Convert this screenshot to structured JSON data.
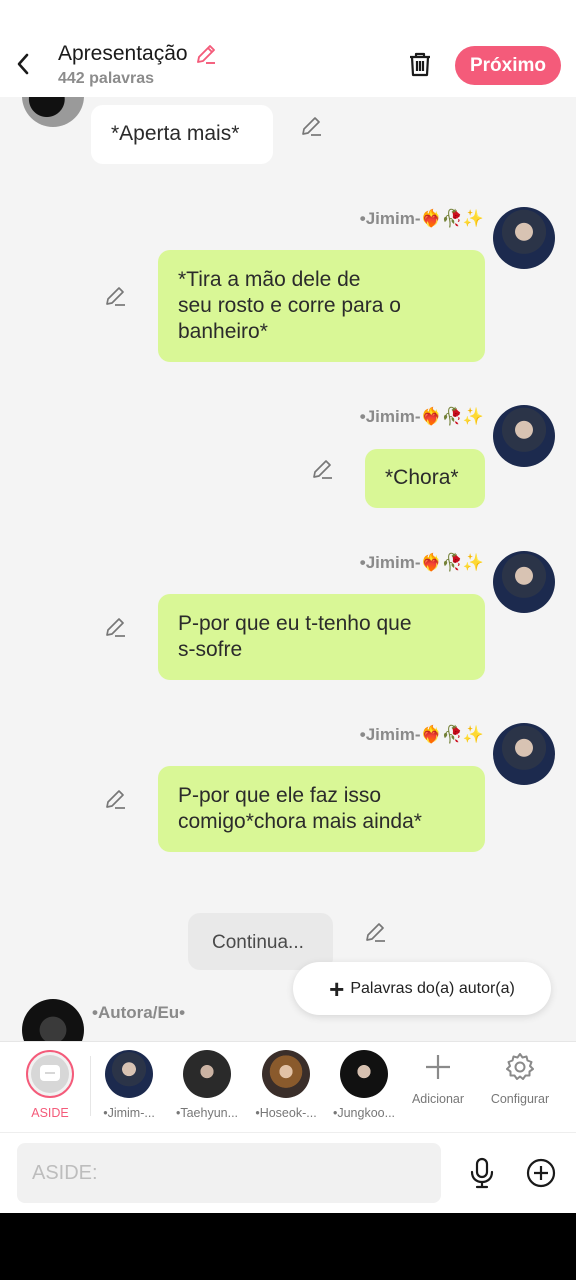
{
  "header": {
    "title": "Apresentação",
    "word_count": "442 palavras",
    "next_label": "Próximo"
  },
  "messages": [
    {
      "author": "",
      "text": "*Aperta mais*",
      "side": "left"
    },
    {
      "author": "•Jimim-❤️‍🔥🥀✨",
      "text": "*Tira a mão dele de\nseu rosto e corre para o\nbanheiro*",
      "side": "right"
    },
    {
      "author": "•Jimim-❤️‍🔥🥀✨",
      "text": "*Chora*",
      "side": "right"
    },
    {
      "author": "•Jimim-❤️‍🔥🥀✨",
      "text": "P-por que eu t-tenho que\ns-sofre",
      "side": "right"
    },
    {
      "author": "•Jimim-❤️‍🔥🥀✨",
      "text": "P-por que ele faz isso\ncomigo*chora mais ainda*",
      "side": "right"
    },
    {
      "author": "",
      "text": "Continua...",
      "side": "aside"
    },
    {
      "author": "•Autora/Eu•",
      "text": "",
      "side": "left"
    }
  ],
  "float_button": {
    "label": "Palavras do(a) autor(a)"
  },
  "characters": [
    {
      "label": "ASIDE"
    },
    {
      "label": "•Jimim-..."
    },
    {
      "label": "•Taehyun..."
    },
    {
      "label": "•Hoseok-..."
    },
    {
      "label": "•Jungkoo..."
    }
  ],
  "tools": {
    "add_label": "Adicionar",
    "settings_label": "Configurar"
  },
  "input": {
    "placeholder": "ASIDE:",
    "value": ""
  },
  "colors": {
    "accent": "#f45b7a",
    "bubble_green": "#d9f796",
    "background": "#f4f4f4"
  },
  "icons": [
    "back-arrow-icon",
    "pencil-icon",
    "trash-icon",
    "edit-icon",
    "plus-icon",
    "gear-icon",
    "microphone-icon",
    "add-circle-icon",
    "chat-bubble-icon"
  ]
}
